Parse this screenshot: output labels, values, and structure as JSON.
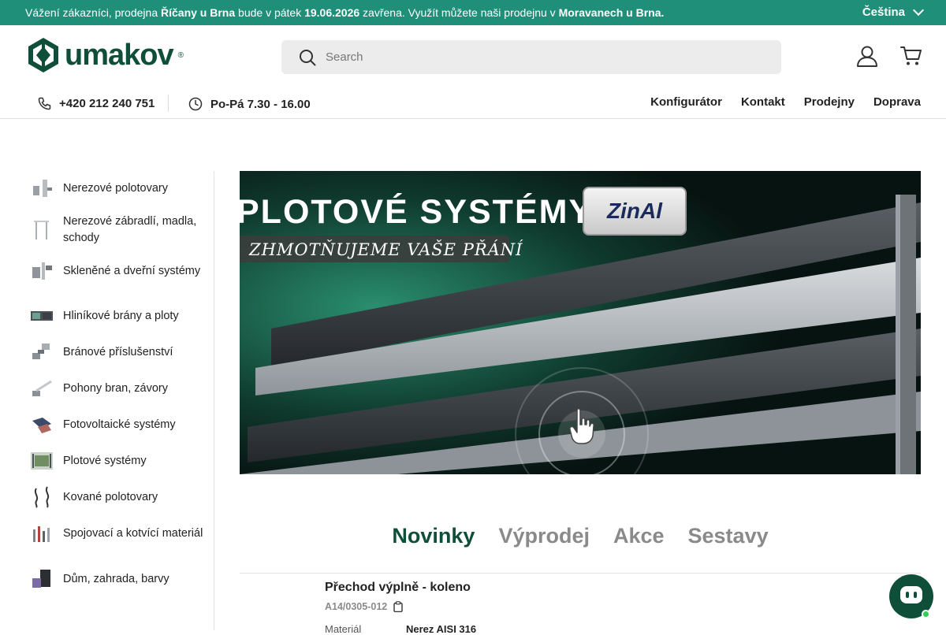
{
  "announcement": {
    "part1": "Vážení zákazníci, prodejna ",
    "store": "Říčany u Brna",
    "part2": " bude v pátek ",
    "date": "19.06.2026",
    "part3": " zavřena. Využít můžete naši prodejnu v ",
    "alt_store": "Moravanech u Brna.",
    "language": "Čeština"
  },
  "header": {
    "logo_text": "umakov",
    "logo_mark": "®",
    "search_placeholder": "Search",
    "phone": "+420 212 240 751",
    "hours": "Po-Pá 7.30 - 16.00",
    "nav": [
      "Konfigurátor",
      "Kontakt",
      "Prodejny",
      "Doprava"
    ]
  },
  "sidebar": {
    "categories": [
      {
        "label": "Nerezové polotovary",
        "icon": "stainless-profiles-icon"
      },
      {
        "label": "Nerezové zábradlí, madla, schody",
        "icon": "railing-icon"
      },
      {
        "label": "Skleněné a dveřní systémy",
        "icon": "glass-door-icon"
      },
      {
        "label": "Hliníkové brány a ploty",
        "icon": "aluminium-gate-icon"
      },
      {
        "label": "Bránové příslušenství",
        "icon": "gate-accessory-icon"
      },
      {
        "label": "Pohony bran, závory",
        "icon": "gate-drive-icon"
      },
      {
        "label": "Fotovoltaické systémy",
        "icon": "solar-panel-icon"
      },
      {
        "label": "Plotové systémy",
        "icon": "fence-system-icon"
      },
      {
        "label": "Kované polotovary",
        "icon": "wrought-iron-icon"
      },
      {
        "label": "Spojovací a kotvící materiál",
        "icon": "fastener-icon"
      },
      {
        "label": "Dům, zahrada, barvy",
        "icon": "paint-can-icon"
      }
    ]
  },
  "banner": {
    "title": "PLOTOVÉ SYSTÉMY",
    "subtitle": "ZHMOTŇUJEME VAŠE PŘÁNÍ",
    "brand": "ZinAl"
  },
  "tabs": [
    {
      "label": "Novinky",
      "active": true
    },
    {
      "label": "Výprodej",
      "active": false
    },
    {
      "label": "Akce",
      "active": false
    },
    {
      "label": "Sestavy",
      "active": false
    }
  ],
  "product": {
    "name": "Přechod výplně - koleno",
    "code": "A14/0305-012",
    "attr_label": "Materiál",
    "attr_value": "Nerez AISI 316"
  },
  "colors": {
    "brand_green": "#1f8f7a",
    "dark_green": "#0f4f3a",
    "online_dot": "#2fcf54"
  }
}
